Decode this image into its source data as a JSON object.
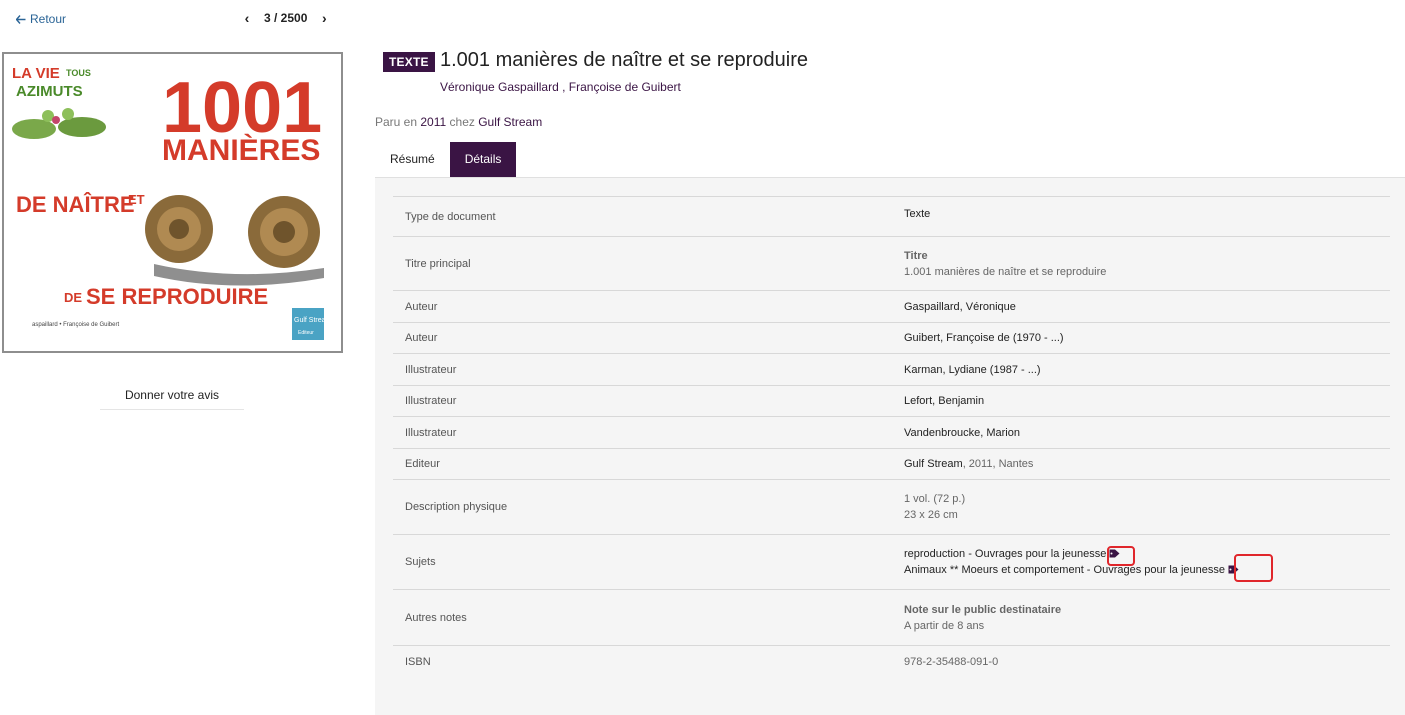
{
  "nav": {
    "back_label": "Retour",
    "pager_text": "3 / 2500"
  },
  "cover": {
    "line_vie": "LA VIE",
    "line_tous": "TOUS",
    "line_azimuts": "AZIMUTS",
    "big_number": "1001",
    "manieres": "MANIÈRES",
    "de_naitre": "DE NAÎTRE",
    "et": "ET",
    "de": "DE",
    "se_reproduire": "SE REPRODUIRE",
    "credits": "aspaillard • Françoise de Guibert",
    "publisher_logo": "Gulf Stream",
    "publisher_sub": "Editeur"
  },
  "review_label": "Donner votre avis",
  "header": {
    "badge": "TEXTE",
    "title": "1.001 manières de naître et se reproduire",
    "author1": "Véronique Gaspaillard",
    "author_sep": " , ",
    "author2": "Françoise de Guibert"
  },
  "published": {
    "prefix": "Paru en ",
    "year": "2011",
    "middle": " chez ",
    "publisher": "Gulf Stream"
  },
  "tabs": [
    {
      "label": "Résumé"
    },
    {
      "label": "Détails"
    }
  ],
  "details": {
    "type_label": "Type de document",
    "type_value": "Texte",
    "title_label": "Titre principal",
    "title_head": "Titre",
    "title_value": "1.001 manières de naître et se reproduire",
    "author_label": "Auteur",
    "author1": "Gaspaillard, Véronique",
    "author2": "Guibert, Françoise de (1970 - ...)",
    "illustrator_label": "Illustrateur",
    "illustrator1": "Karman, Lydiane (1987 - ...)",
    "illustrator2": "Lefort, Benjamin",
    "illustrator3": "Vandenbroucke, Marion",
    "editor_label": "Editeur",
    "editor_name": "Gulf Stream",
    "editor_rest": ", 2011, Nantes",
    "physical_label": "Description physique",
    "physical1": "1 vol. (72 p.)",
    "physical2": "23 x 26 cm",
    "subjects_label": "Sujets",
    "subject1_a": "reproduction",
    "subject1_b": " - Ouvrages pour la jeunesse",
    "subject2_a": "Animaux ** Moeurs et comportement",
    "subject2_b": " - Ouvrages pour la jeunesse",
    "notes_label": "Autres notes",
    "notes_head": "Note sur le public destinataire",
    "notes_value": "A partir de 8 ans",
    "isbn_label": "ISBN",
    "isbn_value": "978-2-35488-091-0"
  },
  "colors": {
    "accent": "#3a1444",
    "link": "#2a6496",
    "highlight": "#e0262b"
  },
  "icons": {
    "back": "arrow-left-icon",
    "prev": "chevron-left-icon",
    "next": "chevron-right-icon",
    "tag": "tag-icon"
  }
}
